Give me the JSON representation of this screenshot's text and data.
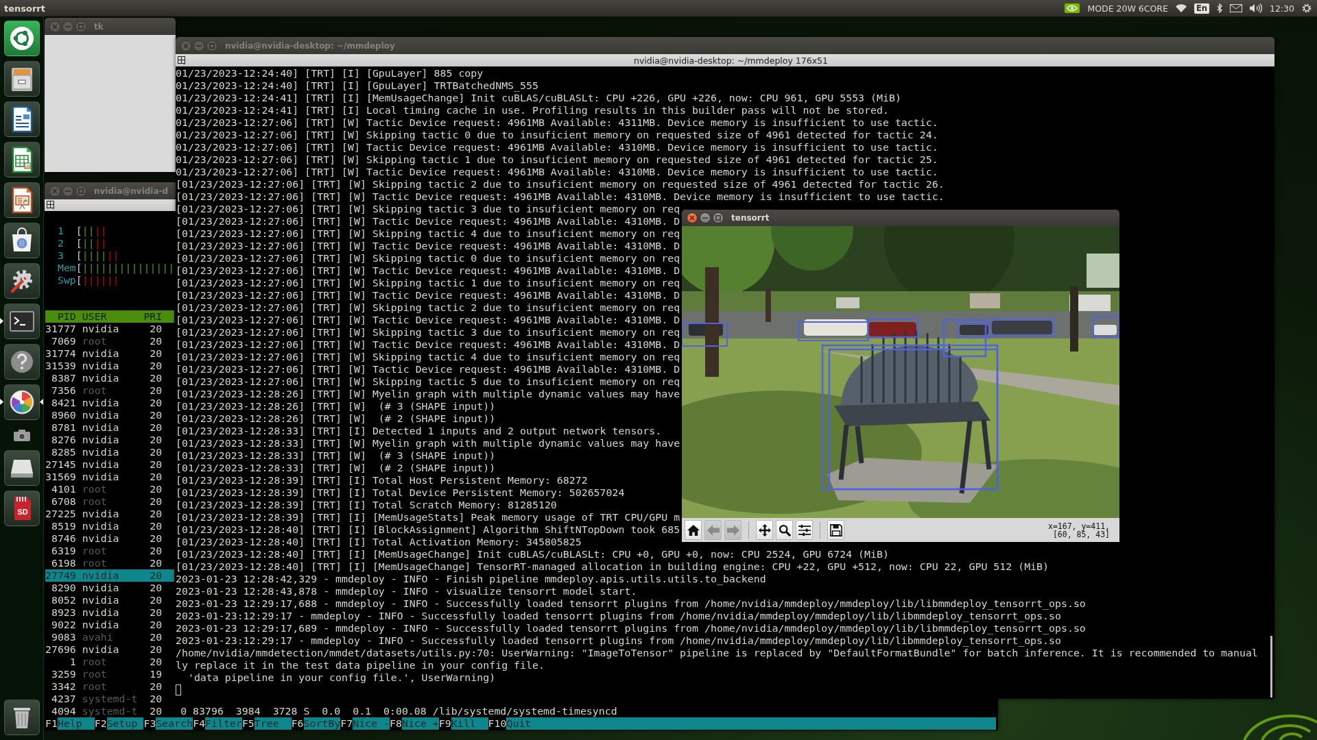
{
  "top_bar": {
    "app_title": "tensorrt",
    "power_mode": "MODE 20W 6CORE",
    "keyboard_layout": "En",
    "clock": "12:30"
  },
  "launcher": [
    {
      "kind": "dash",
      "running": false,
      "focused": false
    },
    {
      "kind": "files",
      "running": false,
      "focused": false
    },
    {
      "kind": "writer",
      "running": false,
      "focused": false
    },
    {
      "kind": "calc",
      "running": false,
      "focused": false
    },
    {
      "kind": "impress",
      "running": false,
      "focused": false
    },
    {
      "kind": "software",
      "running": false,
      "focused": false
    },
    {
      "kind": "settings",
      "running": false,
      "focused": false
    },
    {
      "kind": "terminal",
      "running": true,
      "focused": false
    },
    {
      "kind": "help",
      "running": false,
      "focused": false
    },
    {
      "kind": "pinwheel",
      "running": true,
      "focused": true
    },
    {
      "kind": "camera",
      "running": false,
      "focused": false
    },
    {
      "kind": "drive",
      "running": false,
      "focused": false
    },
    {
      "kind": "sd-card",
      "running": false,
      "focused": false,
      "text": "SD"
    },
    {
      "kind": "trash",
      "running": false,
      "focused": false
    }
  ],
  "tk_window": {
    "title": "tk",
    "focused": false
  },
  "htop_window": {
    "title": "nvidia@nvidia-d",
    "focused": false,
    "meters": [
      {
        "label": "1",
        "bar": [
          {
            "kind": "bracket",
            "text": "["
          },
          {
            "kind": "user",
            "text": "||"
          },
          {
            "kind": "kernel",
            "text": "||"
          }
        ]
      },
      {
        "label": "2",
        "bar": [
          {
            "kind": "bracket",
            "text": "["
          },
          {
            "kind": "user",
            "text": "||"
          },
          {
            "kind": "kernel",
            "text": "||"
          }
        ]
      },
      {
        "label": "3",
        "bar": [
          {
            "kind": "bracket",
            "text": "["
          },
          {
            "kind": "user",
            "text": "||||"
          },
          {
            "kind": "kernel",
            "text": "||"
          }
        ]
      },
      {
        "label": "Mem",
        "bar": [
          {
            "kind": "bracket",
            "text": "["
          },
          {
            "kind": "used",
            "text": "|||||||||||||||"
          }
        ]
      },
      {
        "label": "Swp",
        "bar": [
          {
            "kind": "bracket",
            "text": "["
          },
          {
            "kind": "swap",
            "text": "||||||"
          }
        ]
      }
    ],
    "columns": [
      "PID",
      "USER",
      "PRI"
    ],
    "processes": [
      {
        "pid": "31777",
        "user": "nvidia",
        "pri": "20",
        "dimmed": false,
        "selected": false
      },
      {
        "pid": "7069",
        "user": "root",
        "pri": "20",
        "dimmed": true,
        "selected": false
      },
      {
        "pid": "31774",
        "user": "nvidia",
        "pri": "20",
        "dimmed": false,
        "selected": false
      },
      {
        "pid": "31539",
        "user": "nvidia",
        "pri": "20",
        "dimmed": false,
        "selected": false
      },
      {
        "pid": "8387",
        "user": "nvidia",
        "pri": "20",
        "dimmed": false,
        "selected": false
      },
      {
        "pid": "7356",
        "user": "root",
        "pri": "20",
        "dimmed": true,
        "selected": false
      },
      {
        "pid": "8421",
        "user": "nvidia",
        "pri": "20",
        "dimmed": false,
        "selected": false
      },
      {
        "pid": "8960",
        "user": "nvidia",
        "pri": "20",
        "dimmed": false,
        "selected": false
      },
      {
        "pid": "8781",
        "user": "nvidia",
        "pri": "20",
        "dimmed": false,
        "selected": false
      },
      {
        "pid": "8276",
        "user": "nvidia",
        "pri": "20",
        "dimmed": false,
        "selected": false
      },
      {
        "pid": "8285",
        "user": "nvidia",
        "pri": "20",
        "dimmed": false,
        "selected": false
      },
      {
        "pid": "27145",
        "user": "nvidia",
        "pri": "20",
        "dimmed": false,
        "selected": false
      },
      {
        "pid": "31569",
        "user": "nvidia",
        "pri": "20",
        "dimmed": false,
        "selected": false
      },
      {
        "pid": "4101",
        "user": "root",
        "pri": "20",
        "dimmed": true,
        "selected": false
      },
      {
        "pid": "6708",
        "user": "root",
        "pri": "20",
        "dimmed": true,
        "selected": false
      },
      {
        "pid": "27225",
        "user": "nvidia",
        "pri": "20",
        "dimmed": false,
        "selected": false
      },
      {
        "pid": "8519",
        "user": "nvidia",
        "pri": "20",
        "dimmed": false,
        "selected": false
      },
      {
        "pid": "8746",
        "user": "nvidia",
        "pri": "20",
        "dimmed": false,
        "selected": false
      },
      {
        "pid": "6319",
        "user": "root",
        "pri": "20",
        "dimmed": true,
        "selected": false
      },
      {
        "pid": "6198",
        "user": "root",
        "pri": "20",
        "dimmed": true,
        "selected": false
      },
      {
        "pid": "27749",
        "user": "nvidia",
        "pri": "20",
        "dimmed": false,
        "selected": true
      },
      {
        "pid": "8290",
        "user": "nvidia",
        "pri": "20",
        "dimmed": false,
        "selected": false
      },
      {
        "pid": "8052",
        "user": "nvidia",
        "pri": "20",
        "dimmed": false,
        "selected": false
      },
      {
        "pid": "8923",
        "user": "nvidia",
        "pri": "20",
        "dimmed": false,
        "selected": false
      },
      {
        "pid": "9022",
        "user": "nvidia",
        "pri": "20",
        "dimmed": false,
        "selected": false
      },
      {
        "pid": "9083",
        "user": "avahi",
        "pri": "20",
        "dimmed": true,
        "selected": false
      },
      {
        "pid": "27696",
        "user": "nvidia",
        "pri": "20",
        "dimmed": false,
        "selected": false
      },
      {
        "pid": "1",
        "user": "root",
        "pri": "20",
        "dimmed": true,
        "selected": false
      },
      {
        "pid": "3259",
        "user": "root",
        "pri": "19",
        "dimmed": true,
        "selected": false
      },
      {
        "pid": "3342",
        "user": "root",
        "pri": "20",
        "dimmed": true,
        "selected": false
      },
      {
        "pid": "4237",
        "user": "systemd-t",
        "pri": "20",
        "dimmed": true,
        "selected": false
      },
      {
        "pid": "4094",
        "user": "systemd-t",
        "pri": "20",
        "dimmed": true,
        "selected": false,
        "other_columns": "0 83796  3984  3728 S  0.0  0.1  0:00.08 /lib/systemd/systemd-timesyncd"
      }
    ],
    "function_keys": [
      {
        "key": "F1",
        "label": "Help"
      },
      {
        "key": "F2",
        "label": "Setup"
      },
      {
        "key": "F3",
        "label": "Search"
      },
      {
        "key": "F4",
        "label": "Filter"
      },
      {
        "key": "F5",
        "label": "Tree"
      },
      {
        "key": "F6",
        "label": "SortBy"
      },
      {
        "key": "F7",
        "label": "Nice -"
      },
      {
        "key": "F8",
        "label": "Nice +"
      },
      {
        "key": "F9",
        "label": "Kill"
      },
      {
        "key": "F10",
        "label": "Quit"
      }
    ]
  },
  "terminal_window": {
    "title": "nvidia@nvidia-desktop: ~/mmdeploy",
    "focused": false,
    "tab_title": "nvidia@nvidia-desktop: ~/mmdeploy 176x51",
    "lines": [
      "01/23/2023-12:24:40] [TRT] [I] [GpuLayer] 885 copy",
      "01/23/2023-12:24:40] [TRT] [I] [GpuLayer] TRTBatchedNMS_555",
      "01/23/2023-12:24:41] [TRT] [I] [MemUsageChange] Init cuBLAS/cuBLASLt: CPU +226, GPU +226, now: CPU 961, GPU 5553 (MiB)",
      "01/23/2023-12:24:41] [TRT] [I] Local timing cache in use. Profiling results in this builder pass will not be stored.",
      "01/23/2023-12:27:06] [TRT] [W] Tactic Device request: 4961MB Available: 4311MB. Device memory is insufficient to use tactic.",
      "01/23/2023-12:27:06] [TRT] [W] Skipping tactic 0 due to insuficient memory on requested size of 4961 detected for tactic 24.",
      "01/23/2023-12:27:06] [TRT] [W] Tactic Device request: 4961MB Available: 4310MB. Device memory is insufficient to use tactic.",
      "01/23/2023-12:27:06] [TRT] [W] Skipping tactic 1 due to insuficient memory on requested size of 4961 detected for tactic 25.",
      "01/23/2023-12:27:06] [TRT] [W] Tactic Device request: 4961MB Available: 4310MB. Device memory is insufficient to use tactic.",
      "[01/23/2023-12:27:06] [TRT] [W] Skipping tactic 2 due to insuficient memory on requested size of 4961 detected for tactic 26.",
      "[01/23/2023-12:27:06] [TRT] [W] Tactic Device request: 4961MB Available: 4310MB. Device memory is insufficient to use tactic.",
      "[01/23/2023-12:27:06] [TRT] [W] Skipping tactic 3 due to insuficient memory on req",
      "[01/23/2023-12:27:06] [TRT] [W] Tactic Device request: 4961MB Available: 4310MB. D",
      "[01/23/2023-12:27:06] [TRT] [W] Skipping tactic 4 due to insuficient memory on req",
      "[01/23/2023-12:27:06] [TRT] [W] Tactic Device request: 4961MB Available: 4310MB. D",
      "[01/23/2023-12:27:06] [TRT] [W] Skipping tactic 0 due to insuficient memory on req",
      "[01/23/2023-12:27:06] [TRT] [W] Tactic Device request: 4961MB Available: 4310MB. D",
      "[01/23/2023-12:27:06] [TRT] [W] Skipping tactic 1 due to insuficient memory on req",
      "[01/23/2023-12:27:06] [TRT] [W] Tactic Device request: 4961MB Available: 4310MB. D",
      "[01/23/2023-12:27:06] [TRT] [W] Skipping tactic 2 due to insuficient memory on req",
      "[01/23/2023-12:27:06] [TRT] [W] Tactic Device request: 4961MB Available: 4310MB. D",
      "[01/23/2023-12:27:06] [TRT] [W] Skipping tactic 3 due to insuficient memory on req",
      "[01/23/2023-12:27:06] [TRT] [W] Tactic Device request: 4961MB Available: 4310MB. D",
      "[01/23/2023-12:27:06] [TRT] [W] Skipping tactic 4 due to insuficient memory on req",
      "[01/23/2023-12:27:06] [TRT] [W] Tactic Device request: 4961MB Available: 4310MB. D",
      "[01/23/2023-12:27:06] [TRT] [W] Skipping tactic 5 due to insuficient memory on req",
      "[01/23/2023-12:28:26] [TRT] [W] Myelin graph with multiple dynamic values may have",
      "[01/23/2023-12:28:26] [TRT] [W]  (# 3 (SHAPE input))",
      "[01/23/2023-12:28:26] [TRT] [W]  (# 2 (SHAPE input))",
      "[01/23/2023-12:28:33] [TRT] [I] Detected 1 inputs and 2 output network tensors.",
      "[01/23/2023-12:28:33] [TRT] [W] Myelin graph with multiple dynamic values may have",
      "[01/23/2023-12:28:33] [TRT] [W]  (# 3 (SHAPE input))",
      "[01/23/2023-12:28:33] [TRT] [W]  (# 2 (SHAPE input))",
      "[01/23/2023-12:28:39] [TRT] [I] Total Host Persistent Memory: 68272",
      "[01/23/2023-12:28:39] [TRT] [I] Total Device Persistent Memory: 502657024",
      "[01/23/2023-12:28:39] [TRT] [I] Total Scratch Memory: 81285120",
      "[01/23/2023-12:28:39] [TRT] [I] [MemUsageStats] Peak memory usage of TRT CPU/GPU m",
      "[01/23/2023-12:28:40] [TRT] [I] [BlockAssignment] Algorithm ShiftNTopDown took 685",
      "[01/23/2023-12:28:40] [TRT] [I] Total Activation Memory: 345805825",
      "[01/23/2023-12:28:40] [TRT] [I] [MemUsageChange] Init cuBLAS/cuBLASLt: CPU +0, GPU +0, now: CPU 2524, GPU 6724 (MiB)",
      "[01/23/2023-12:28:40] [TRT] [I] [MemUsageChange] TensorRT-managed allocation in building engine: CPU +22, GPU +512, now: CPU 22, GPU 512 (MiB)",
      "2023-01-23 12:28:42,329 - mmdeploy - INFO - Finish pipeline mmdeploy.apis.utils.utils.to_backend",
      "2023-01-23 12:28:43,878 - mmdeploy - INFO - visualize tensorrt model start.",
      "2023-01-23 12:29:17,688 - mmdeploy - INFO - Successfully loaded tensorrt plugins from /home/nvidia/mmdeploy/mmdeploy/lib/libmmdeploy_tensorrt_ops.so",
      "2023-01-23:12:29:17 - mmdeploy - INFO - Successfully loaded tensorrt plugins from /home/nvidia/mmdeploy/mmdeploy/lib/libmmdeploy_tensorrt_ops.so",
      "2023-01-23 12:29:17,689 - mmdeploy - INFO - Successfully loaded tensorrt plugins from /home/nvidia/mmdeploy/mmdeploy/lib/libmmdeploy_tensorrt_ops.so",
      "2023-01-23:12:29:17 - mmdeploy - INFO - Successfully loaded tensorrt plugins from /home/nvidia/mmdeploy/mmdeploy/lib/libmmdeploy_tensorrt_ops.so",
      "/home/nvidia/mmdetection/mmdet/datasets/utils.py:70: UserWarning: \"ImageToTensor\" pipeline is replaced by \"DefaultFormatBundle\" for batch inference. It is recommended to manual",
      "ly replace it in the test data pipeline in your config file.",
      "  'data pipeline in your config file.', UserWarning)"
    ]
  },
  "image_window": {
    "title": "tensorrt",
    "focused": true,
    "toolbar_groups": [
      [
        {
          "kind": "home",
          "disabled": false
        },
        {
          "kind": "back",
          "disabled": true
        },
        {
          "kind": "forward",
          "disabled": true
        }
      ],
      [
        {
          "kind": "pan",
          "disabled": false
        },
        {
          "kind": "zoom",
          "disabled": false
        },
        {
          "kind": "configure",
          "disabled": false
        }
      ],
      [
        {
          "kind": "save",
          "disabled": false
        }
      ]
    ],
    "cursor_position": "x=167, y=411,",
    "pixel_value": "[60, 85, 43]"
  }
}
